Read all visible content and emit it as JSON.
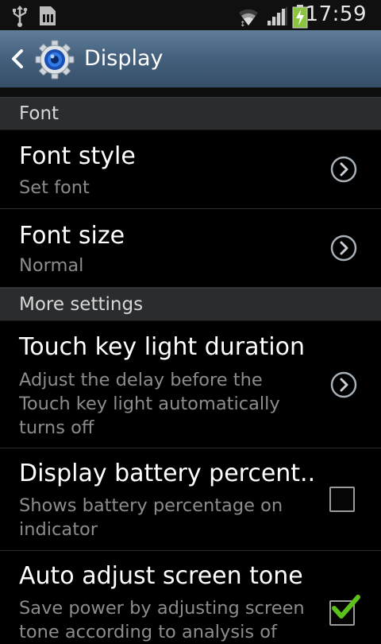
{
  "status_bar": {
    "time": "17:59",
    "icons": [
      "usb-icon",
      "sd-card-icon",
      "wifi-icon",
      "signal-icon",
      "battery-charging-icon"
    ]
  },
  "action_bar": {
    "title": "Display",
    "back_icon": "chevron-left-icon",
    "app_icon": "settings-gear-icon"
  },
  "sections": [
    {
      "header": "Font",
      "items": [
        {
          "title": "Font style",
          "subtitle": "Set font",
          "control": "chevron"
        },
        {
          "title": "Font size",
          "subtitle": "Normal",
          "control": "chevron"
        }
      ]
    },
    {
      "header": "More settings",
      "items": [
        {
          "title": "Touch key light duration",
          "subtitle": "Adjust the delay before the Touch key light automatically turns off",
          "control": "chevron"
        },
        {
          "title": "Display battery percent..",
          "subtitle": "Shows battery percentage on indicator",
          "control": "checkbox",
          "checked": false
        },
        {
          "title": "Auto adjust screen tone",
          "subtitle": "Save power by adjusting screen tone according to analysis of",
          "control": "checkbox",
          "checked": true
        }
      ]
    }
  ],
  "colors": {
    "accent_check": "#5cc11b",
    "action_bar": "#46627e"
  }
}
